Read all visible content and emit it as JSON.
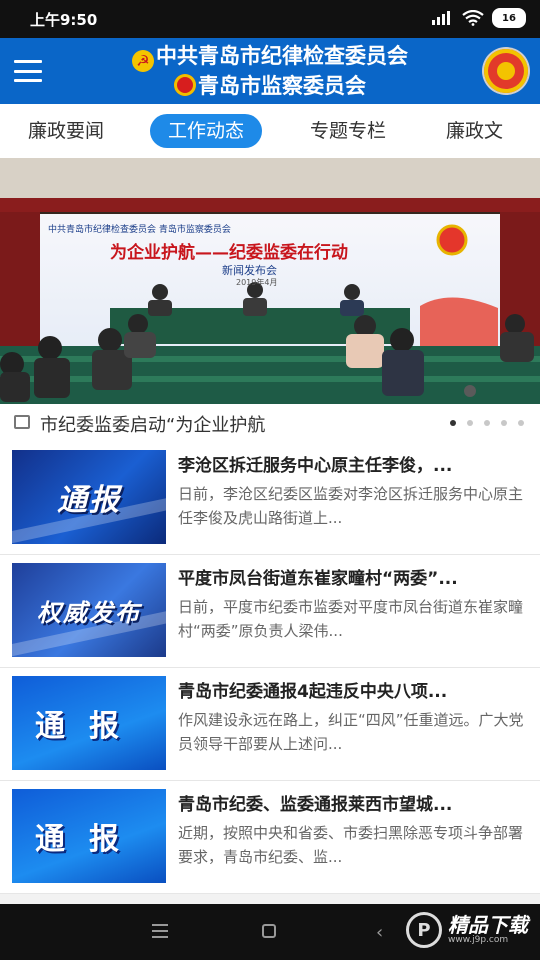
{
  "status": {
    "time": "上午9:50",
    "battery": "16"
  },
  "header": {
    "title_line1": "中共青岛市纪律检查委员会",
    "title_line2": "青岛市监察委员会"
  },
  "tabs": [
    {
      "label": "廉政要闻"
    },
    {
      "label": "工作动态"
    },
    {
      "label": "专题专栏"
    },
    {
      "label": "廉政文"
    }
  ],
  "banner": {
    "backdrop_org": "中共青岛市纪律检查委员会  青岛市监察委员会",
    "backdrop_title": "为企业护航——纪委监委在行动",
    "backdrop_subtitle": "新闻发布会",
    "backdrop_date": "2019年4月",
    "caption": "市纪委监委启动“为企业护航",
    "active_dot": 0,
    "dot_count": 5
  },
  "news": [
    {
      "thumb_text": "通报",
      "title": "李沧区拆迁服务中心原主任李俊，...",
      "summary": "日前，李沧区纪委区监委对李沧区拆迁服务中心原主任李俊及虎山路街道上..."
    },
    {
      "thumb_text": "权威发布",
      "title": "平度市凤台街道东崔家疃村“两委”...",
      "summary": "日前，平度市纪委市监委对平度市凤台街道东崔家疃村“两委”原负责人梁伟..."
    },
    {
      "thumb_text": "通报",
      "title": "青岛市纪委通报4起违反中央八项...",
      "summary": "作风建设永远在路上，纠正“四风”任重道远。广大党员领导干部要从上述问..."
    },
    {
      "thumb_text": "通报",
      "title": "青岛市纪委、监委通报莱西市望城...",
      "summary": "近期，按照中央和省委、市委扫黑除恶专项斗争部署要求，青岛市纪委、监..."
    }
  ],
  "watermark": {
    "brand": "精品下载",
    "url": "www.j9p.com"
  }
}
